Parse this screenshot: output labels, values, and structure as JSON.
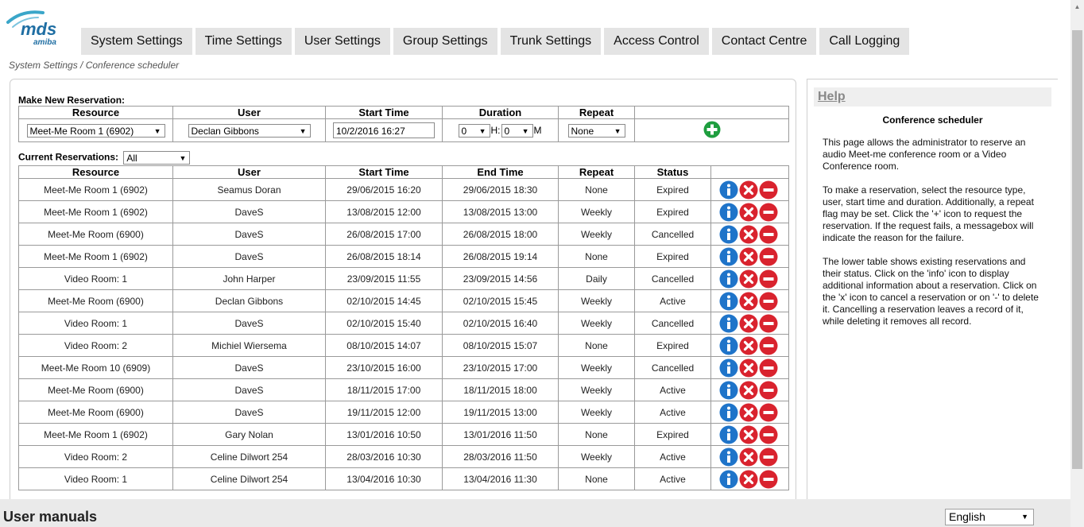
{
  "logo": {
    "brand": "mds",
    "sub": "amiba"
  },
  "nav": {
    "tabs": [
      {
        "label": "System Settings"
      },
      {
        "label": "Time Settings"
      },
      {
        "label": "User Settings"
      },
      {
        "label": "Group Settings"
      },
      {
        "label": "Trunk Settings"
      },
      {
        "label": "Access Control"
      },
      {
        "label": "Contact Centre"
      },
      {
        "label": "Call Logging"
      }
    ]
  },
  "breadcrumb": "System Settings / Conference scheduler",
  "new_reservation": {
    "label": "Make New Reservation:",
    "headers": {
      "resource": "Resource",
      "user": "User",
      "start": "Start Time",
      "duration": "Duration",
      "repeat": "Repeat"
    },
    "resource": "Meet-Me Room 1 (6902)",
    "user": "Declan Gibbons",
    "start_time": "10/2/2016 16:27",
    "duration_hours": "0",
    "hours_unit": "H:",
    "duration_minutes": "0",
    "minutes_unit": "M",
    "repeat": "None"
  },
  "current": {
    "label": "Current Reservations:",
    "filter": "All",
    "headers": {
      "resource": "Resource",
      "user": "User",
      "start": "Start Time",
      "end": "End Time",
      "repeat": "Repeat",
      "status": "Status"
    },
    "rows": [
      {
        "resource": "Meet-Me Room 1 (6902)",
        "user": "Seamus Doran",
        "start": "29/06/2015 16:20",
        "end": "29/06/2015 18:30",
        "repeat": "None",
        "status": "Expired"
      },
      {
        "resource": "Meet-Me Room 1 (6902)",
        "user": "DaveS",
        "start": "13/08/2015 12:00",
        "end": "13/08/2015 13:00",
        "repeat": "Weekly",
        "status": "Expired"
      },
      {
        "resource": "Meet-Me Room (6900)",
        "user": "DaveS",
        "start": "26/08/2015 17:00",
        "end": "26/08/2015 18:00",
        "repeat": "Weekly",
        "status": "Cancelled"
      },
      {
        "resource": "Meet-Me Room 1 (6902)",
        "user": "DaveS",
        "start": "26/08/2015 18:14",
        "end": "26/08/2015 19:14",
        "repeat": "None",
        "status": "Expired"
      },
      {
        "resource": "Video Room: 1",
        "user": "John Harper",
        "start": "23/09/2015 11:55",
        "end": "23/09/2015 14:56",
        "repeat": "Daily",
        "status": "Cancelled"
      },
      {
        "resource": "Meet-Me Room (6900)",
        "user": "Declan Gibbons",
        "start": "02/10/2015 14:45",
        "end": "02/10/2015 15:45",
        "repeat": "Weekly",
        "status": "Active"
      },
      {
        "resource": "Video Room: 1",
        "user": "DaveS",
        "start": "02/10/2015 15:40",
        "end": "02/10/2015 16:40",
        "repeat": "Weekly",
        "status": "Cancelled"
      },
      {
        "resource": "Video Room: 2",
        "user": "Michiel Wiersema",
        "start": "08/10/2015 14:07",
        "end": "08/10/2015 15:07",
        "repeat": "None",
        "status": "Expired"
      },
      {
        "resource": "Meet-Me Room 10 (6909)",
        "user": "DaveS",
        "start": "23/10/2015 16:00",
        "end": "23/10/2015 17:00",
        "repeat": "Weekly",
        "status": "Cancelled"
      },
      {
        "resource": "Meet-Me Room (6900)",
        "user": "DaveS",
        "start": "18/11/2015 17:00",
        "end": "18/11/2015 18:00",
        "repeat": "Weekly",
        "status": "Active"
      },
      {
        "resource": "Meet-Me Room (6900)",
        "user": "DaveS",
        "start": "19/11/2015 12:00",
        "end": "19/11/2015 13:00",
        "repeat": "Weekly",
        "status": "Active"
      },
      {
        "resource": "Meet-Me Room 1 (6902)",
        "user": "Gary Nolan",
        "start": "13/01/2016 10:50",
        "end": "13/01/2016 11:50",
        "repeat": "None",
        "status": "Expired"
      },
      {
        "resource": "Video Room: 2",
        "user": "Celine Dilwort 254",
        "start": "28/03/2016 10:30",
        "end": "28/03/2016 11:50",
        "repeat": "Weekly",
        "status": "Active"
      },
      {
        "resource": "Video Room: 1",
        "user": "Celine Dilwort 254",
        "start": "13/04/2016 10:30",
        "end": "13/04/2016 11:30",
        "repeat": "None",
        "status": "Active"
      }
    ]
  },
  "help": {
    "header": "Help",
    "title": "Conference scheduler",
    "paragraphs": [
      "This page allows the administrator to reserve an audio Meet-me conference room or a Video Conference room.",
      "To make a reservation, select the resource type, user, start time and duration. Additionally, a repeat flag may be set. Click the '+' icon to request the reservation. If the request fails, a messagebox will indicate the reason for the failure.",
      "The lower table shows existing reservations and their status. Click on the 'info' icon to display additional information about a reservation. Click on the 'x' icon to cancel a reservation or on '-' to delete it. Cancelling a reservation leaves a record of it, while deleting it removes all record."
    ]
  },
  "footer": {
    "title": "User manuals",
    "language": "English"
  },
  "colors": {
    "info": "#1f74c9",
    "cancel": "#d9232e",
    "delete": "#d9232e",
    "add": "#1e9e3f"
  },
  "icons": {
    "info": "info-icon",
    "cancel": "cancel-x-icon",
    "delete": "delete-minus-icon",
    "add": "add-plus-icon"
  }
}
